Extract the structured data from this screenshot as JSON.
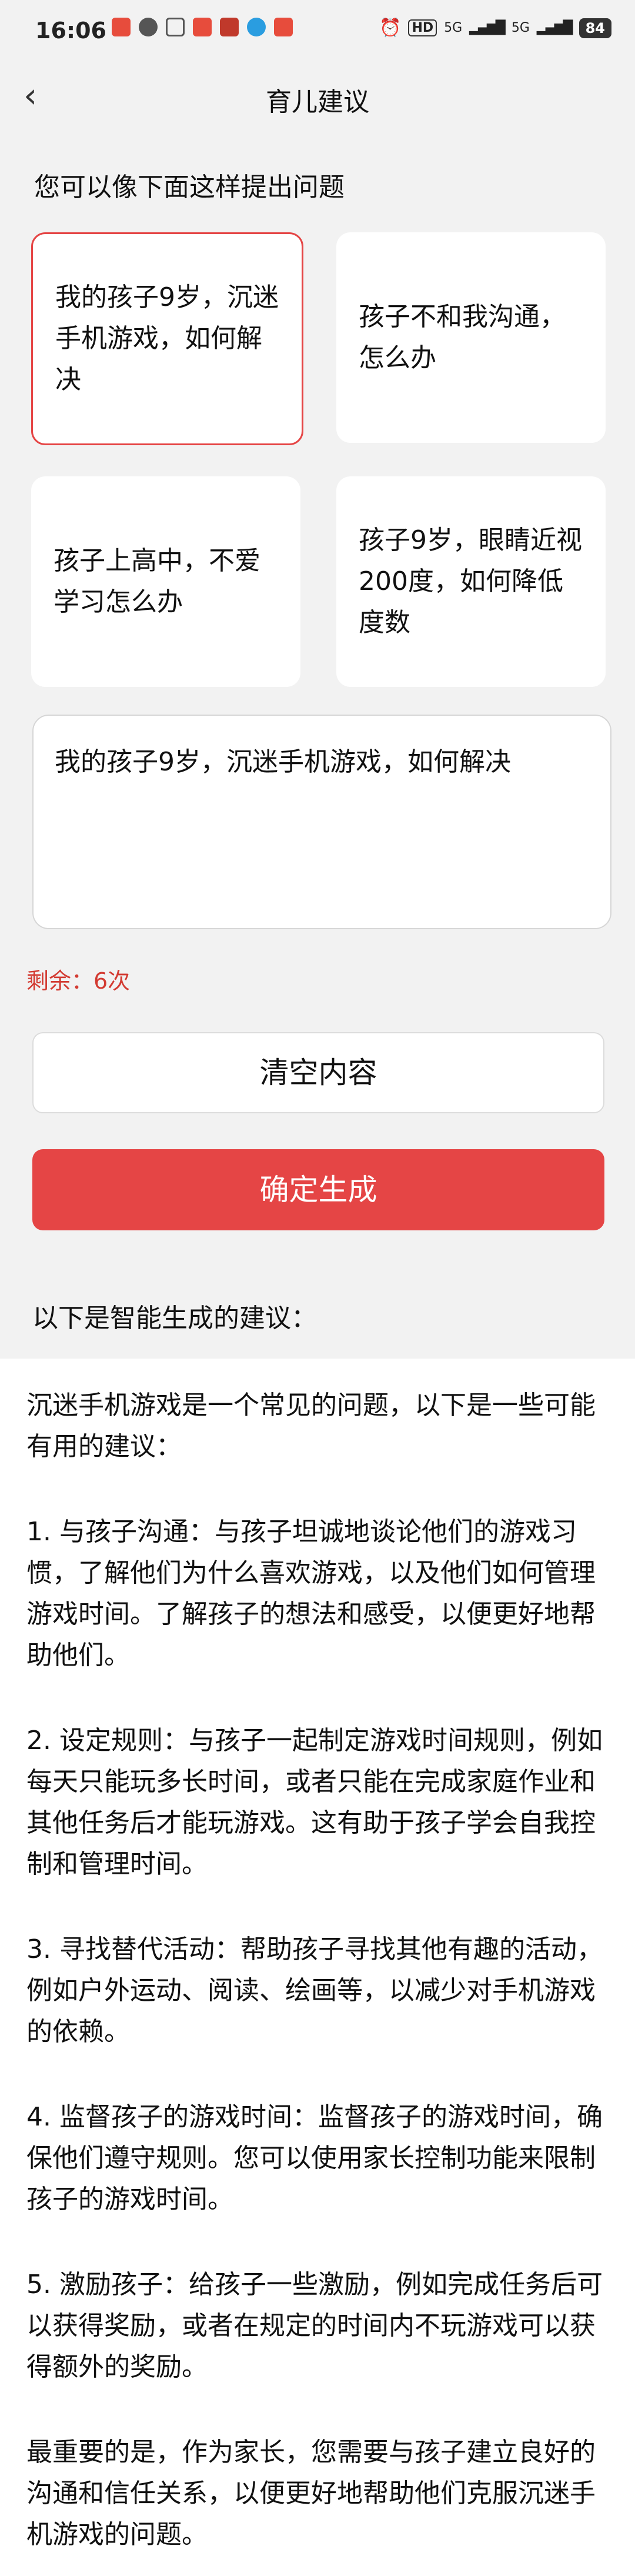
{
  "status": {
    "time": "16:06",
    "hd": "HD",
    "signal1": "5G",
    "signal2": "5G",
    "battery": "84"
  },
  "header": {
    "title": "育儿建议"
  },
  "prompt": "您可以像下面这样提出问题",
  "examples": [
    "我的孩子9岁，沉迷手机游戏，如何解决",
    "孩子不和我沟通，怎么办",
    "孩子上高中，不爱学习怎么办",
    "孩子9岁，眼睛近视200度，如何降低度数"
  ],
  "input": {
    "value": "我的孩子9岁，沉迷手机游戏，如何解决"
  },
  "remaining": "剩余：6次",
  "buttons": {
    "clear": "清空内容",
    "generate": "确定生成"
  },
  "result_title": "以下是智能生成的建议：",
  "result": {
    "intro": "沉迷手机游戏是一个常见的问题，以下是一些可能有用的建议：",
    "items": [
      "1. 与孩子沟通：与孩子坦诚地谈论他们的游戏习惯，了解他们为什么喜欢游戏，以及他们如何管理游戏时间。了解孩子的想法和感受，以便更好地帮助他们。",
      "2. 设定规则：与孩子一起制定游戏时间规则，例如每天只能玩多长时间，或者只能在完成家庭作业和其他任务后才能玩游戏。这有助于孩子学会自我控制和管理时间。",
      "3. 寻找替代活动：帮助孩子寻找其他有趣的活动，例如户外运动、阅读、绘画等，以减少对手机游戏的依赖。",
      "4. 监督孩子的游戏时间：监督孩子的游戏时间，确保他们遵守规则。您可以使用家长控制功能来限制孩子的游戏时间。",
      "5. 激励孩子：给孩子一些激励，例如完成任务后可以获得奖励，或者在规定的时间内不玩游戏可以获得额外的奖励。"
    ],
    "conclusion": "最重要的是，作为家长，您需要与孩子建立良好的沟通和信任关系，以便更好地帮助他们克服沉迷手机游戏的问题。"
  },
  "colors": {
    "accent": "#e54545",
    "remaining": "#d33b32",
    "background": "#f2f2f2"
  }
}
